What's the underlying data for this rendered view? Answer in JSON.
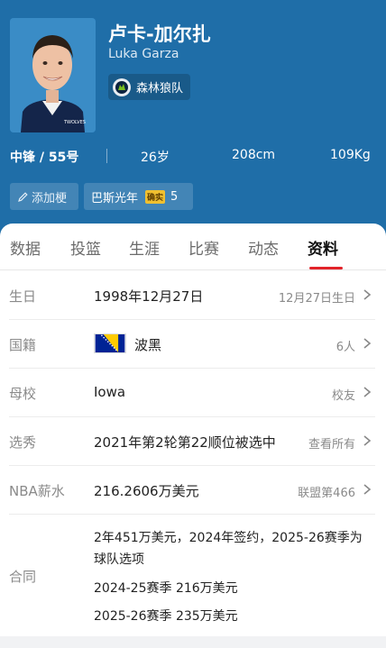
{
  "player": {
    "name_cn": "卢卡-加尔扎",
    "name_en": "Luka Garza",
    "team": "森林狼队",
    "team_logo_icon": "timberwolves-logo-icon",
    "jersey_text": "TWOLVES"
  },
  "stats": {
    "position_number": "中锋 / 55号",
    "age": "26岁",
    "height": "208cm",
    "weight": "109Kg"
  },
  "chips": {
    "add_meme": "添加梗",
    "tag_label": "巴斯光年",
    "verified_badge": "确实",
    "tag_count": "5"
  },
  "tabs": [
    "数据",
    "投篮",
    "生涯",
    "比赛",
    "动态",
    "资料"
  ],
  "active_tab": "资料",
  "profile": {
    "birthday": {
      "label": "生日",
      "value": "1998年12月27日",
      "extra": "12月27日生日"
    },
    "nationality": {
      "label": "国籍",
      "value": "波黑",
      "extra": "6人"
    },
    "school": {
      "label": "母校",
      "value": "Iowa",
      "extra": "校友"
    },
    "draft": {
      "label": "选秀",
      "value": "2021年第2轮第22顺位被选中",
      "extra": "查看所有"
    },
    "salary": {
      "label": "NBA薪水",
      "value": "216.2606万美元",
      "extra": "联盟第466"
    },
    "contract": {
      "label": "合同",
      "summary_line1": "2年451万美元，2024年签约，2025-26赛季为",
      "summary_line2": "球队选项",
      "season1": "2024-25赛季 216万美元",
      "season2": "2025-26赛季 235万美元"
    }
  },
  "colors": {
    "header_bg": "#1f6ea8",
    "tab_indicator": "#e2232a",
    "flag_blue": "#002395",
    "flag_yellow": "#fecb00"
  }
}
